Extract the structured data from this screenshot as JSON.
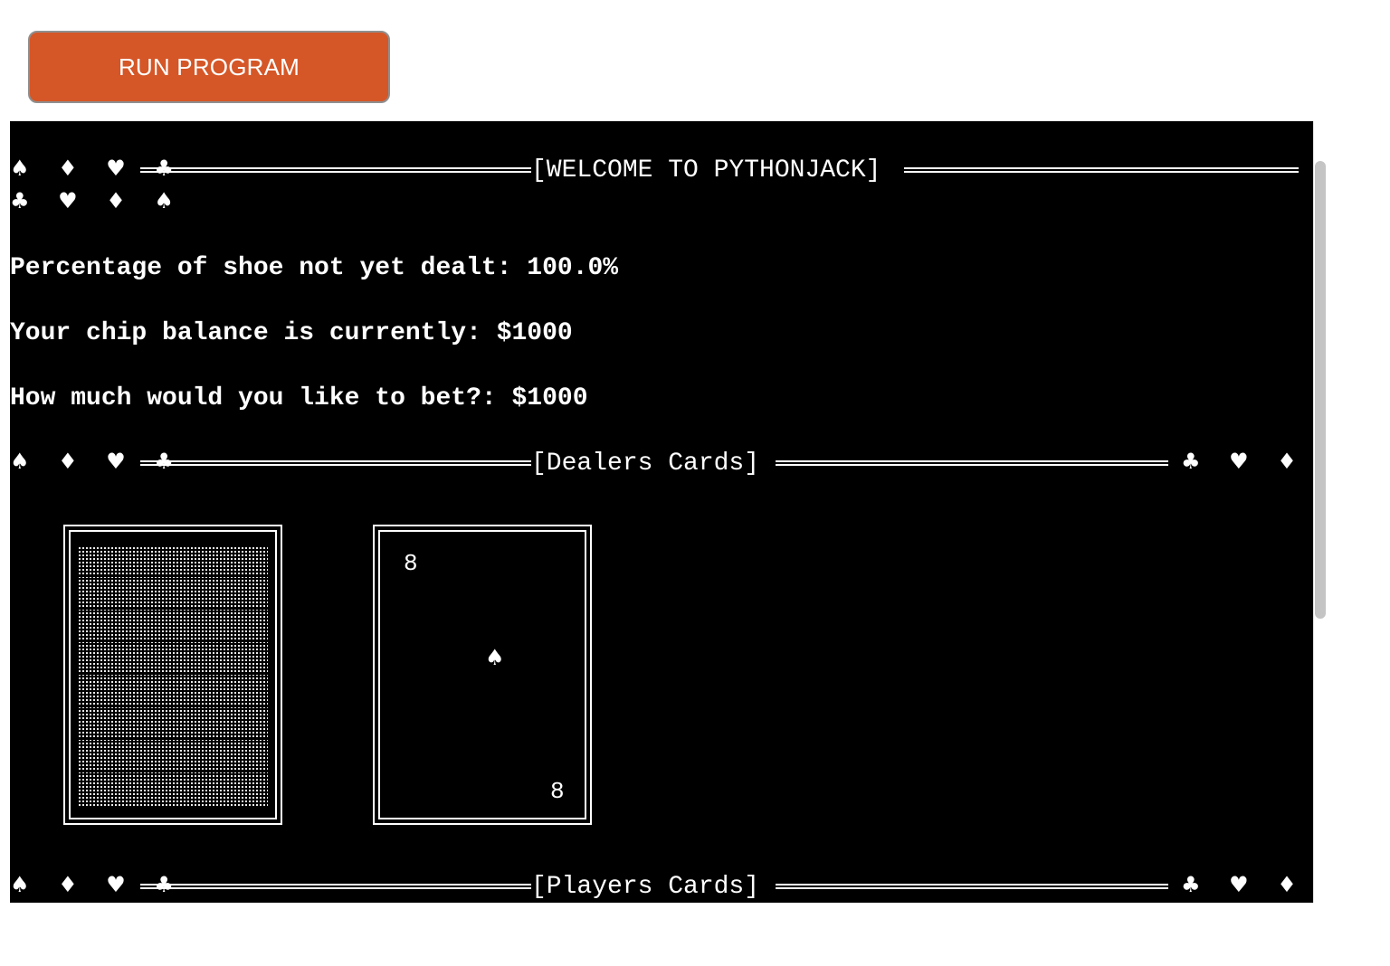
{
  "toolbar": {
    "run_label": "RUN PROGRAM"
  },
  "colors": {
    "run_button_bg": "#d55627",
    "terminal_bg": "#000000",
    "terminal_fg": "#ffffff"
  },
  "terminal": {
    "welcome": {
      "suits_left": "♠ ♦ ♥ ♣",
      "title": "[WELCOME TO PYTHONJACK]",
      "suits_wrapped": "♣ ♥ ♦ ♠"
    },
    "shoe_line": "Percentage of shoe not yet dealt: 100.0%",
    "balance_line": "Your chip balance is currently: $1000",
    "bet_line": "How much would you like to bet?: $1000",
    "dealer_header": {
      "suits_left": "♠ ♦ ♥ ♣",
      "title": "[Dealers Cards]",
      "suits_right": "♣ ♥ ♦ ♠"
    },
    "dealer_cards": [
      {
        "face": "down",
        "icon": "card-back-pattern"
      },
      {
        "face": "up",
        "rank_top": "8",
        "suit": "♠",
        "rank_bottom": "8"
      }
    ],
    "player_header": {
      "suits_left": "♠ ♦ ♥ ♣",
      "title": "[Players Cards]",
      "suits_right": "♣ ♥ ♦ ♠"
    }
  }
}
